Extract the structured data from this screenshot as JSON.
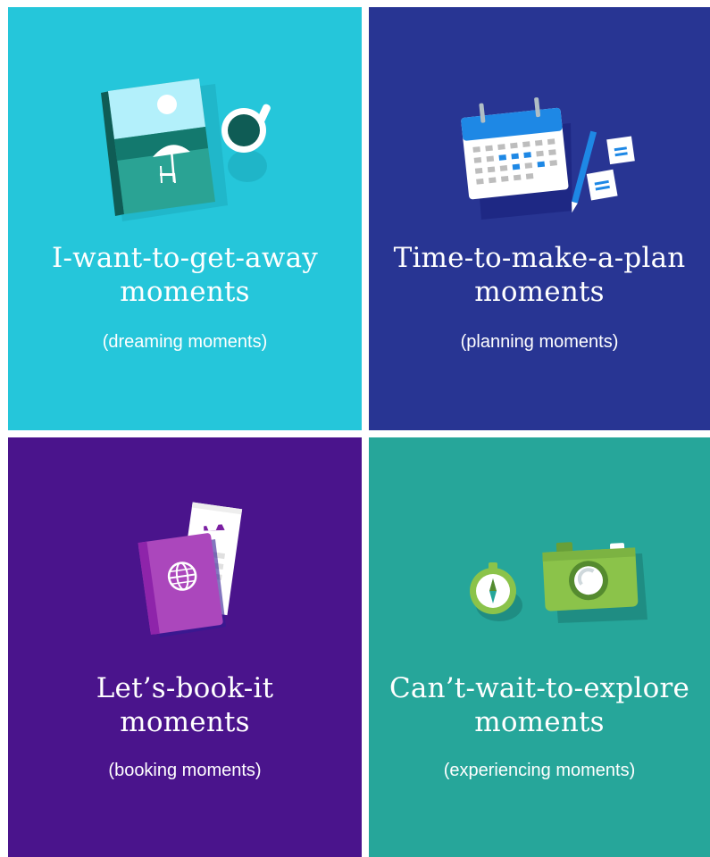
{
  "tiles": [
    {
      "headline_line1": "I-want-to-get-away",
      "headline_line2": "moments",
      "subtitle": "(dreaming moments)",
      "color": "#25c6da",
      "icon": "beach-book-coffee-icon"
    },
    {
      "headline_line1": "Time-to-make-a-plan",
      "headline_line2": "moments",
      "subtitle": "(planning moments)",
      "color": "#283593",
      "icon": "calendar-pencil-notes-icon"
    },
    {
      "headline_line1": "Let’s-book-it",
      "headline_line2": "moments",
      "subtitle": "(booking moments)",
      "color": "#4a148c",
      "icon": "passport-ticket-icon"
    },
    {
      "headline_line1": "Can’t-wait-to-explore",
      "headline_line2": "moments",
      "subtitle": "(experiencing moments)",
      "color": "#26a69a",
      "icon": "compass-camera-icon"
    }
  ]
}
